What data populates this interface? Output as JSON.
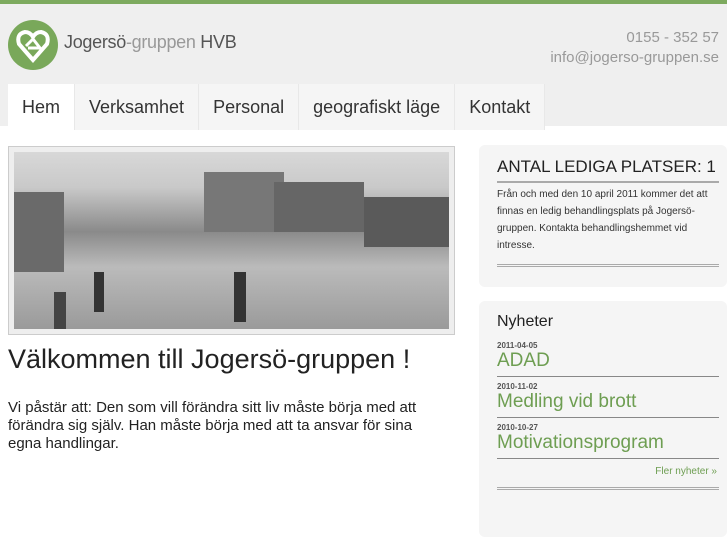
{
  "brand": {
    "name_part1": "Jogersö",
    "name_part2": "-gruppen",
    "name_part3": " HVB"
  },
  "contact": {
    "phone": "0155 - 352 57",
    "email": "info@jogerso-gruppen.se"
  },
  "nav": [
    {
      "label": "Hem"
    },
    {
      "label": "Verksamhet"
    },
    {
      "label": "Personal"
    },
    {
      "label": "geografiskt läge"
    },
    {
      "label": "Kontakt"
    }
  ],
  "main": {
    "title": "Välkommen till Jogersö-gruppen !",
    "intro": "Vi påstär att: Den som vill förändra sitt liv måste börja med att förändra sig själv. Han måste börja med att ta ansvar för sina egna handlingar."
  },
  "vacancies": {
    "title": "ANTAL LEDIGA PLATSER: 1",
    "text": "Från och med den 10 april 2011 kommer det att finnas en ledig behandlingsplats på Jogersö-gruppen. Kontakta behandlingshemmet vid intresse."
  },
  "news": {
    "title": "Nyheter",
    "items": [
      {
        "date": "2011-04-05",
        "title": "ADAD"
      },
      {
        "date": "2010-11-02",
        "title": "Medling vid brott"
      },
      {
        "date": "2010-10-27",
        "title": "Motivationsprogram"
      }
    ],
    "more": "Fler nyheter »"
  }
}
